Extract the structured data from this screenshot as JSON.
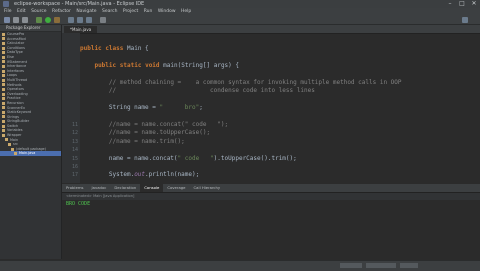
{
  "window": {
    "title": "eclipse-workspace - Main/src/Main.java - Eclipse IDE"
  },
  "menu": [
    "File",
    "Edit",
    "Source",
    "Refactor",
    "Navigate",
    "Search",
    "Project",
    "Run",
    "Window",
    "Help"
  ],
  "left_panel": {
    "title": "Package Explorer",
    "items": [
      "CoursePro",
      "AccessMod",
      "Calculator",
      "Conditions",
      "DataType",
      "Else",
      "IfStatement",
      "Inheritance",
      "Interfaces",
      "Loops",
      "MultiThread",
      "Methods",
      "Operators",
      "Overloading",
      "Practice",
      "Recursion",
      "ScannerEx",
      "StaticKeyword",
      "Strings",
      "StringBuilder",
      "Switch",
      "Variables",
      "Wrapper",
      "Main",
      "src",
      "(default package)",
      "Main.java"
    ],
    "selected": "Main.java"
  },
  "editor": {
    "tab": "*Main.java",
    "lines": [
      {
        "n": "",
        "parts": [
          [
            "plain",
            ""
          ]
        ]
      },
      {
        "n": "",
        "parts": [
          [
            "kw",
            "public"
          ],
          [
            "plain",
            " "
          ],
          [
            "kw",
            "class"
          ],
          [
            "plain",
            " Main {"
          ]
        ]
      },
      {
        "n": "",
        "parts": [
          [
            "plain",
            ""
          ]
        ]
      },
      {
        "n": "",
        "parts": [
          [
            "plain",
            "    "
          ],
          [
            "kw",
            "public"
          ],
          [
            "plain",
            " "
          ],
          [
            "kw",
            "static"
          ],
          [
            "plain",
            " "
          ],
          [
            "kw",
            "void"
          ],
          [
            "plain",
            " main(String[] args) {"
          ]
        ]
      },
      {
        "n": "",
        "parts": [
          [
            "plain",
            ""
          ]
        ]
      },
      {
        "n": "",
        "parts": [
          [
            "plain",
            "        "
          ],
          [
            "cm",
            "// method chaining =    a common syntax for invoking multiple method calls in OOP"
          ]
        ]
      },
      {
        "n": "",
        "parts": [
          [
            "plain",
            "        "
          ],
          [
            "cm",
            "//                          condense code into less lines"
          ]
        ]
      },
      {
        "n": "",
        "parts": [
          [
            "plain",
            ""
          ]
        ]
      },
      {
        "n": "",
        "parts": [
          [
            "plain",
            "        String name = "
          ],
          [
            "str",
            "\"      bro\""
          ],
          [
            "plain",
            ";"
          ]
        ]
      },
      {
        "n": "",
        "parts": [
          [
            "plain",
            ""
          ]
        ]
      },
      {
        "n": "11",
        "parts": [
          [
            "plain",
            "        "
          ],
          [
            "cm",
            "//name = name.concat(\" code   \");"
          ]
        ]
      },
      {
        "n": "12",
        "parts": [
          [
            "plain",
            "        "
          ],
          [
            "cm",
            "//name = name.toUpperCase();"
          ]
        ]
      },
      {
        "n": "13",
        "parts": [
          [
            "plain",
            "        "
          ],
          [
            "cm",
            "//name = name.trim();"
          ]
        ]
      },
      {
        "n": "14",
        "parts": [
          [
            "plain",
            ""
          ]
        ]
      },
      {
        "n": "15",
        "parts": [
          [
            "plain",
            "        name = name.concat("
          ],
          [
            "str",
            "\" code   \""
          ],
          [
            "plain",
            ").toUpperCase().trim();"
          ]
        ]
      },
      {
        "n": "16",
        "parts": [
          [
            "plain",
            ""
          ]
        ]
      },
      {
        "n": "17",
        "parts": [
          [
            "plain",
            "        System."
          ],
          [
            "fld",
            "out"
          ],
          [
            "plain",
            ".println(name);"
          ]
        ]
      }
    ]
  },
  "bottom": {
    "tabs": [
      "Problems",
      "Javadoc",
      "Declaration",
      "Console",
      "Coverage",
      "Call Hierarchy"
    ],
    "active_tab": "Console",
    "console_header": "<terminated> Main [Java Application]",
    "output": "BRO CODE"
  },
  "colors": {
    "keyword": "#cc7832",
    "comment": "#808080",
    "string": "#6a8759",
    "console_green": "#4fc24f"
  }
}
